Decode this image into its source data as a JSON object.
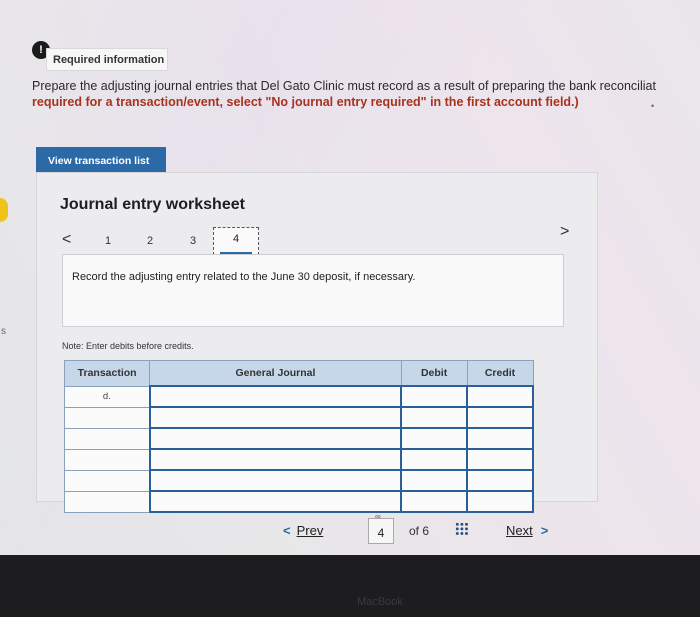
{
  "required": {
    "icon": "!",
    "label": "Required information"
  },
  "prompt": {
    "line1": "Prepare the adjusting journal entries that Del Gato Clinic must record as a result of preparing the bank reconciliat",
    "line2": "required for a transaction/event, select \"No journal entry required\" in the first account field.)"
  },
  "view_button": "View transaction list",
  "worksheet": {
    "title": "Journal entry worksheet",
    "pages": [
      "1",
      "2",
      "3",
      "4"
    ],
    "active_page": "4",
    "instruction": "Record the adjusting entry related to the June 30 deposit, if necessary.",
    "note": "Note: Enter debits before credits.",
    "columns": [
      "Transaction",
      "General Journal",
      "Debit",
      "Credit"
    ],
    "rows": [
      {
        "transaction": "d.",
        "account": "",
        "debit": "",
        "credit": ""
      },
      {
        "transaction": "",
        "account": "",
        "debit": "",
        "credit": ""
      },
      {
        "transaction": "",
        "account": "",
        "debit": "",
        "credit": ""
      },
      {
        "transaction": "",
        "account": "",
        "debit": "",
        "credit": ""
      },
      {
        "transaction": "",
        "account": "",
        "debit": "",
        "credit": ""
      },
      {
        "transaction": "",
        "account": "",
        "debit": "",
        "credit": ""
      }
    ]
  },
  "pager": {
    "prev": "Prev",
    "current": "4",
    "of": "of 6",
    "next": "Next"
  },
  "device": {
    "brand": "MacBook"
  }
}
